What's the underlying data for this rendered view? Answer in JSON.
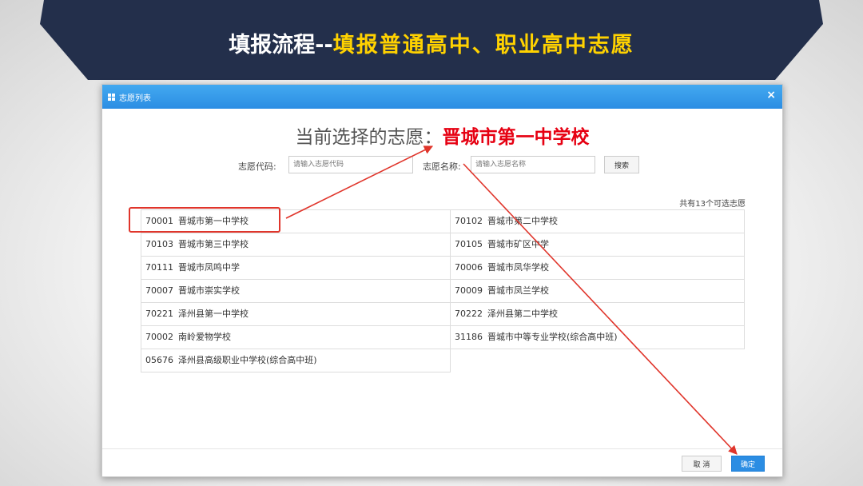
{
  "banner": {
    "title_white": "填报流程--",
    "title_yellow": "填报普通高中、职业高中志愿"
  },
  "dialog": {
    "title": "志愿列表",
    "close_icon": "×",
    "current_label": "当前选择的志愿：",
    "current_value": "晋城市第一中学校",
    "search": {
      "code_label": "志愿代码:",
      "code_placeholder": "请输入志愿代码",
      "name_label": "志愿名称:",
      "name_placeholder": "请输入志愿名称",
      "search_button": "搜索"
    },
    "count_text": "共有13个可选志愿",
    "schools": [
      {
        "code": "70001",
        "name": "晋城市第一中学校"
      },
      {
        "code": "70102",
        "name": "晋城市第二中学校"
      },
      {
        "code": "70103",
        "name": "晋城市第三中学校"
      },
      {
        "code": "70105",
        "name": "晋城市矿区中学"
      },
      {
        "code": "70111",
        "name": "晋城市凤鸣中学"
      },
      {
        "code": "70006",
        "name": "晋城市凤华学校"
      },
      {
        "code": "70007",
        "name": "晋城市崇实学校"
      },
      {
        "code": "70009",
        "name": "晋城市凤兰学校"
      },
      {
        "code": "70221",
        "name": "泽州县第一中学校"
      },
      {
        "code": "70222",
        "name": "泽州县第二中学校"
      },
      {
        "code": "70002",
        "name": "南岭爱物学校"
      },
      {
        "code": "31186",
        "name": "晋城市中等专业学校(综合高中班)"
      },
      {
        "code": "05676",
        "name": "泽州县高级职业中学校(综合高中班)"
      }
    ],
    "cancel_button": "取 消",
    "ok_button": "确定"
  },
  "colors": {
    "banner_bg": "#232f4b",
    "title_yellow": "#ffd200",
    "header_blue": "#2b8de3",
    "highlight_red": "#e60012"
  }
}
